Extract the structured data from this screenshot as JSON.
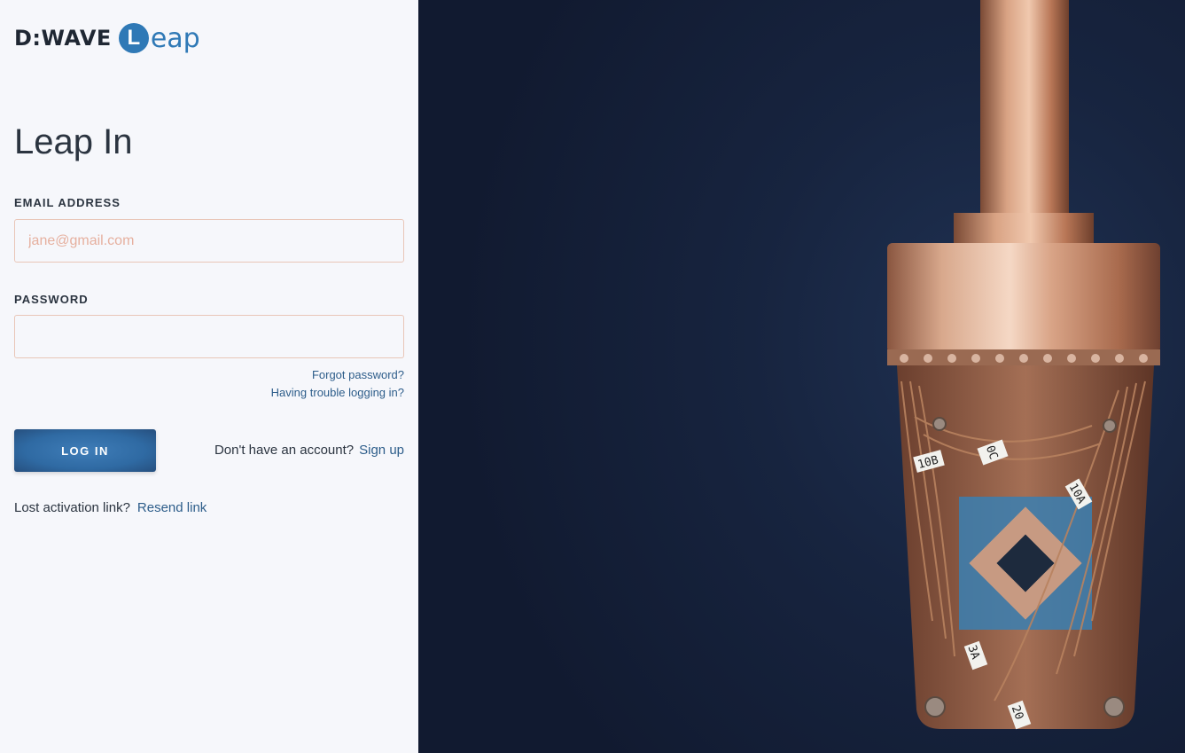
{
  "logo": {
    "brand": "D:WAVE",
    "product_initial": "L",
    "product_rest": "eap"
  },
  "page_title": "Leap In",
  "form": {
    "email_label": "EMAIL ADDRESS",
    "email_placeholder": "jane@gmail.com",
    "email_value": "",
    "password_label": "PASSWORD",
    "password_value": "",
    "forgot_password": "Forgot password?",
    "trouble_logging_in": "Having trouble logging in?",
    "login_button": "LOG IN",
    "no_account_text": "Don't have an account?",
    "sign_up_link": "Sign up",
    "lost_activation_text": "Lost activation link?",
    "resend_link": "Resend link"
  },
  "hero_image": {
    "labels": [
      "10B",
      "0C",
      "10A",
      "3A",
      "20"
    ]
  },
  "colors": {
    "accent": "#2f79b6",
    "link": "#2d5d8a",
    "background_panel": "#f6f7fb",
    "hero_bg": "#17243f",
    "copper": "#c98a6a"
  }
}
